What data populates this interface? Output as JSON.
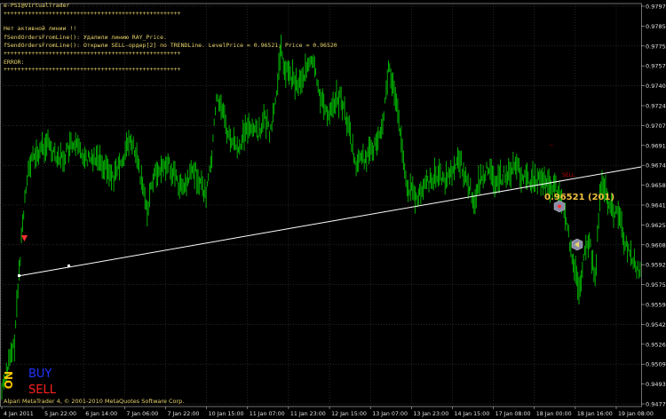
{
  "log": {
    "lines": [
      "e-PSI@VirtualTrader",
      "+++++++++++++++++++++++++++++++++++++++++++++++++++",
      "Нет активной линии !!",
      "fSendOrdersFromLine(): Удалили линию RAY_Price.",
      "fSendOrdersFromLine(): Открыли SELL-ордер[2] по TRENDLine. LevelPrice = 0.96521; Price = 0.96520",
      "+++++++++++++++++++++++++++++++++++++++++++++++++++",
      "ERROR:",
      "+++++++++++++++++++++++++++++++++++++++++++++++++++"
    ]
  },
  "buttons": {
    "on_label": "ON",
    "buy_label": "BUY",
    "sell_label": "SELL"
  },
  "footer": "Alpari MetaTrader 4, © 2001-2010 MetaQuotes Software Corp.",
  "annotations": {
    "price_label": "0.96521 (201)",
    "sell_marker": "SELL"
  },
  "price_axis": [
    "0.97970",
    "0.97855",
    "0.97755",
    "0.97570",
    "0.97405",
    "0.97240",
    "0.97075",
    "0.96910",
    "0.96745",
    "0.96580",
    "0.96415",
    "0.96250",
    "0.96085",
    "0.95920",
    "0.95755",
    "0.95590",
    "0.95425",
    "0.95260",
    "0.95095",
    "0.94930",
    "0.94770"
  ],
  "time_axis": [
    "4 Jan 2011",
    "5 Jan 22:00",
    "6 Jan 14:00",
    "7 Jan 06:00",
    "7 Jan 22:00",
    "10 Jan 15:00",
    "11 Jan 07:00",
    "11 Jan 23:00",
    "12 Jan 15:00",
    "13 Jan 07:00",
    "13 Jan 23:00",
    "14 Jan 15:00",
    "17 Jan 08:00",
    "18 Jan 00:00",
    "18 Jan 16:00",
    "19 Jan 08:00"
  ],
  "colors": {
    "background": "#000000",
    "bars": "#00c000",
    "trendline": "#ffffff",
    "grid": "#5a5a5a",
    "text": "#e8d36a"
  }
}
